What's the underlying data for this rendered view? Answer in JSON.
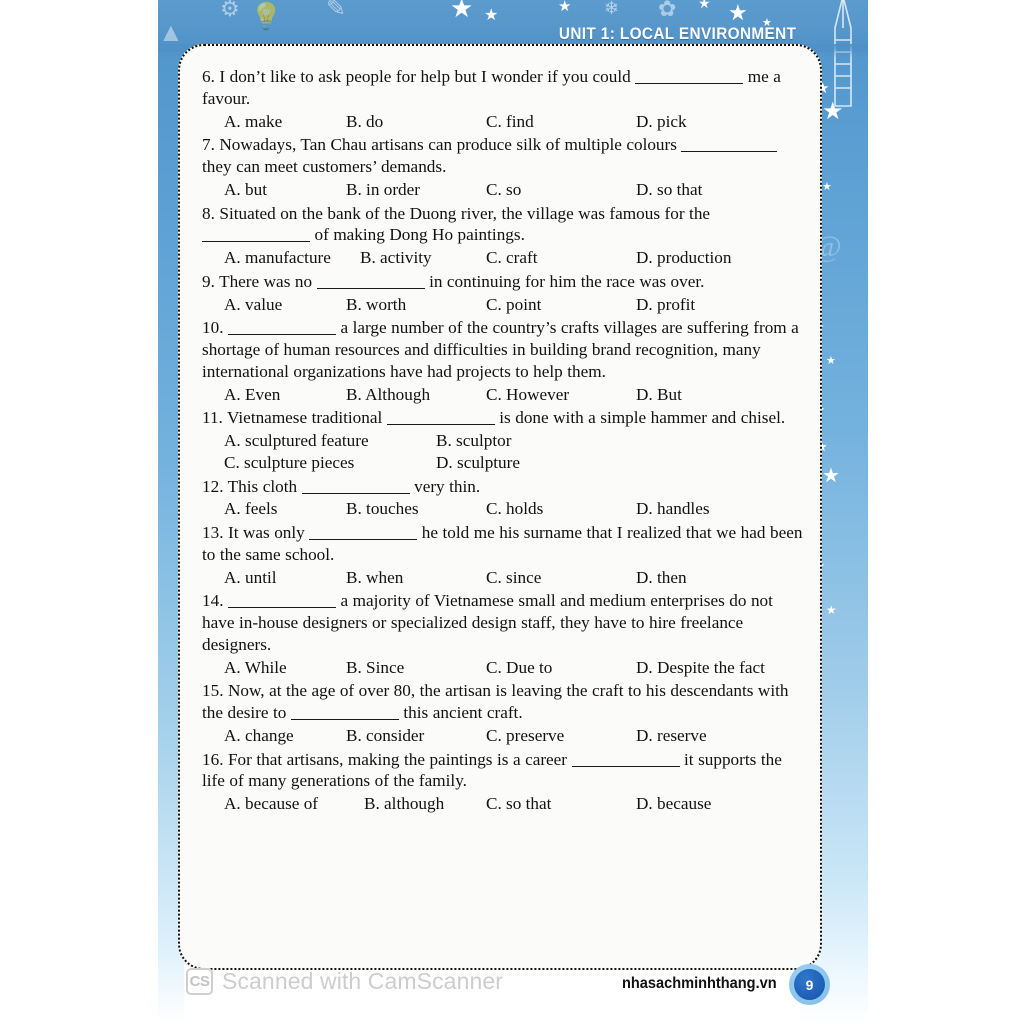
{
  "header": {
    "unit_title": "UNIT 1: LOCAL ENVIRONMENT"
  },
  "colors": {
    "band_blue": "#5b9bcd",
    "page_badge_blue": "#1f62b8",
    "page_badge_ring": "#8ec6ee",
    "card_bg": "#fbfbfa",
    "text": "#14110f",
    "watermark_gray": "#cdcdcd"
  },
  "questions": [
    {
      "stem_a": "6. I don’t like to ask people for help but I wonder if you could",
      "stem_b": "me",
      "stem_c": "a favour.",
      "layout": "4col",
      "options": [
        "A. make",
        "B. do",
        "C. find",
        "D. pick"
      ]
    },
    {
      "stem_a": "7. Nowadays, Tan Chau artisans can produce silk of multiple colours",
      "stem_b": "",
      "stem_c": "they can meet customers’ demands.",
      "layout": "4col",
      "options": [
        "A. but",
        "B. in order",
        "C. so",
        "D. so that"
      ]
    },
    {
      "stem_a": "8. Situated on the bank of the Duong river, the village was famous for the",
      "stem_b": "",
      "stem_c": "of making Dong Ho paintings.",
      "layout": "4col",
      "options": [
        "A. manufacture",
        "B. activity",
        "C. craft",
        "D. production"
      ]
    },
    {
      "stem_a": "9. There was no",
      "stem_b": "in continuing for him the race was over.",
      "stem_c": "",
      "layout": "4col",
      "options": [
        "A. value",
        "B. worth",
        "C. point",
        "D. profit"
      ]
    },
    {
      "stem_a": "10.",
      "stem_b": "a large number of the country’s crafts villages are suffering from",
      "stem_c": "a shortage of human resources and difficulties in building brand recognition, many international organizations have had projects to help them.",
      "layout": "4col",
      "options": [
        "A. Even",
        "B. Although",
        "C. However",
        "D. But"
      ]
    },
    {
      "stem_a": "11. Vietnamese traditional",
      "stem_b": "is done with a simple hammer and chisel.",
      "stem_c": "",
      "layout": "2col",
      "options": [
        "A. sculptured feature",
        "B. sculptor",
        "C. sculpture pieces",
        "D. sculpture"
      ]
    },
    {
      "stem_a": "12. This cloth",
      "stem_b": "very thin.",
      "stem_c": "",
      "layout": "4col",
      "options": [
        "A. feels",
        "B. touches",
        "C. holds",
        "D. handles"
      ]
    },
    {
      "stem_a": "13. It was only",
      "stem_b": "he told me his surname that I realized that we had",
      "stem_c": "been to the same school.",
      "layout": "4col",
      "options": [
        "A. until",
        "B. when",
        "C. since",
        "D. then"
      ]
    },
    {
      "stem_a": "14.",
      "stem_b": "a majority of Vietnamese small and medium enterprises do not have",
      "stem_c": "in-house designers or specialized design staff, they have to hire freelance designers.",
      "layout": "4col",
      "options": [
        "A. While",
        "B. Since",
        "C. Due to",
        "D. Despite the fact"
      ]
    },
    {
      "stem_a": "15. Now, at the age of over 80, the artisan is leaving the craft to his descendants with the desire to",
      "stem_b": "this ancient craft.",
      "stem_c": "",
      "layout": "4col",
      "options": [
        "A. change",
        "B. consider",
        "C. preserve",
        "D. reserve"
      ]
    },
    {
      "stem_a": "16. For that artisans, making the paintings is a career",
      "stem_b": "it supports",
      "stem_c": "the life of many generations of the family.",
      "layout": "4col",
      "options": [
        "A. because of",
        "B. although",
        "C. so that",
        "D. because"
      ]
    }
  ],
  "footer": {
    "watermark_badge": "CS",
    "watermark_text": "Scanned with CamScanner",
    "website": "nhasachminhthang.vn",
    "page_number": "9"
  }
}
